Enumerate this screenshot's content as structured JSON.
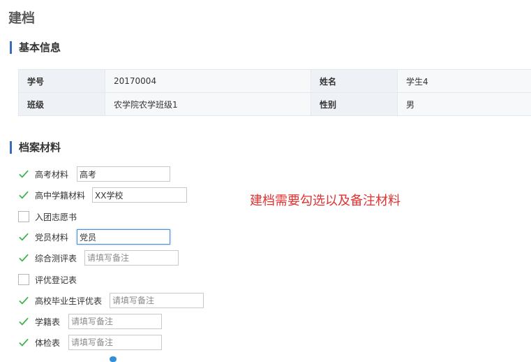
{
  "page_title": "建档",
  "basic_info": {
    "section_title": "基本信息",
    "rows": [
      [
        {
          "label": "学号",
          "value": "20170004"
        },
        {
          "label": "姓名",
          "value": "学生4"
        }
      ],
      [
        {
          "label": "班级",
          "value": "农学院农学班级1"
        },
        {
          "label": "性别",
          "value": "男"
        }
      ]
    ]
  },
  "materials": {
    "section_title": "档案材料",
    "placeholder": "请填写备注",
    "items": [
      {
        "label": "高考材料",
        "checked": true,
        "has_input": true,
        "value": "高考"
      },
      {
        "label": "高中学籍材料",
        "checked": true,
        "has_input": true,
        "value": "XX学校"
      },
      {
        "label": "入团志愿书",
        "checked": false,
        "has_input": false,
        "value": ""
      },
      {
        "label": "党员材料",
        "checked": true,
        "has_input": true,
        "value": "党员",
        "focused": true
      },
      {
        "label": "综合测评表",
        "checked": true,
        "has_input": true,
        "value": ""
      },
      {
        "label": "评优登记表",
        "checked": false,
        "has_input": false,
        "value": ""
      },
      {
        "label": "高校毕业生评优表",
        "checked": true,
        "has_input": true,
        "value": ""
      },
      {
        "label": "学籍表",
        "checked": true,
        "has_input": true,
        "value": ""
      },
      {
        "label": "体检表",
        "checked": true,
        "has_input": true,
        "value": ""
      }
    ]
  },
  "annotation": "建档需要勾选以及备注材料",
  "colors": {
    "check": "#3cb34a",
    "accent_bar": "#3b6bc0",
    "annotation": "#e03232",
    "focus_border": "#4a90d9"
  },
  "icons": {
    "checked": "check-mark-icon",
    "unchecked": "empty-checkbox-icon"
  }
}
